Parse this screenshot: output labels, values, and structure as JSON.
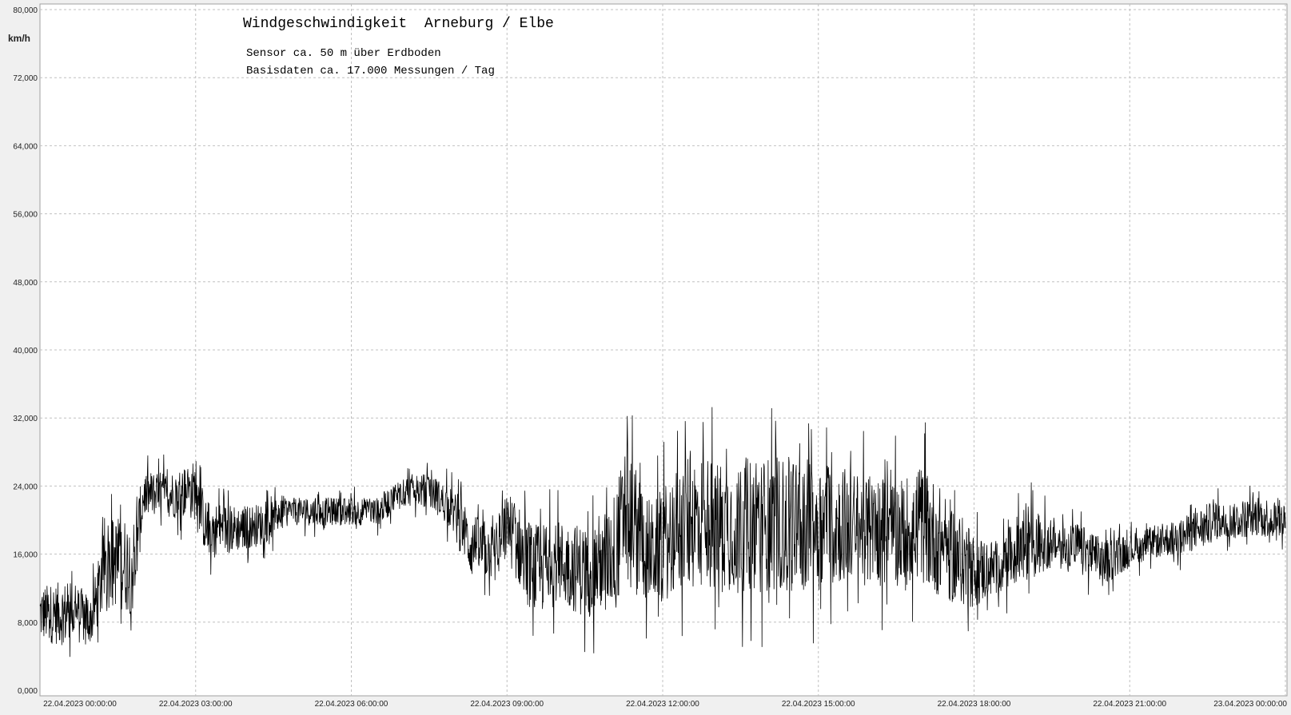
{
  "chart_data": {
    "type": "line",
    "title": "Windgeschwindigkeit  Arneburg / Elbe",
    "subtitle_lines": [
      "Sensor ca. 50 m über Erdboden",
      "Basisdaten ca. 17.000 Messungen / Tag"
    ],
    "ylabel": "km/h",
    "ylim": [
      0,
      80
    ],
    "yticks": [
      "0,000",
      "8,000",
      "16,000",
      "24,000",
      "32,000",
      "40,000",
      "48,000",
      "56,000",
      "64,000",
      "72,000",
      "80,000"
    ],
    "xlim": [
      "22.04.2023 00:00:00",
      "23.04.2023 00:00:00"
    ],
    "xticks": [
      {
        "date": "22.04.2023",
        "time": "00:00:00"
      },
      {
        "date": "22.04.2023",
        "time": "03:00:00"
      },
      {
        "date": "22.04.2023",
        "time": "06:00:00"
      },
      {
        "date": "22.04.2023",
        "time": "09:00:00"
      },
      {
        "date": "22.04.2023",
        "time": "12:00:00"
      },
      {
        "date": "22.04.2023",
        "time": "15:00:00"
      },
      {
        "date": "22.04.2023",
        "time": "18:00:00"
      },
      {
        "date": "22.04.2023",
        "time": "21:00:00"
      },
      {
        "date": "23.04.2023",
        "time": "00:00:00"
      }
    ],
    "grid": true,
    "series_color": "#000000",
    "envelope": [
      {
        "t": 0.0,
        "min": 3,
        "max": 15
      },
      {
        "t": 0.5,
        "min": 2,
        "max": 16
      },
      {
        "t": 1.0,
        "min": 3,
        "max": 14
      },
      {
        "t": 1.3,
        "min": 6,
        "max": 25
      },
      {
        "t": 1.8,
        "min": 4,
        "max": 25
      },
      {
        "t": 2.0,
        "min": 18,
        "max": 28
      },
      {
        "t": 2.5,
        "min": 18,
        "max": 28
      },
      {
        "t": 3.0,
        "min": 17,
        "max": 30
      },
      {
        "t": 3.2,
        "min": 13,
        "max": 25
      },
      {
        "t": 3.8,
        "min": 14,
        "max": 24
      },
      {
        "t": 4.3,
        "min": 15,
        "max": 24
      },
      {
        "t": 4.8,
        "min": 18,
        "max": 24
      },
      {
        "t": 5.3,
        "min": 18,
        "max": 24
      },
      {
        "t": 5.8,
        "min": 18,
        "max": 24
      },
      {
        "t": 6.5,
        "min": 18,
        "max": 24
      },
      {
        "t": 7.0,
        "min": 20,
        "max": 27
      },
      {
        "t": 7.5,
        "min": 20,
        "max": 27
      },
      {
        "t": 7.9,
        "min": 17,
        "max": 26
      },
      {
        "t": 8.3,
        "min": 10,
        "max": 24
      },
      {
        "t": 8.8,
        "min": 10,
        "max": 22
      },
      {
        "t": 9.0,
        "min": 12,
        "max": 27
      },
      {
        "t": 9.5,
        "min": 4,
        "max": 24
      },
      {
        "t": 10.0,
        "min": 6,
        "max": 24
      },
      {
        "t": 10.5,
        "min": 4,
        "max": 24
      },
      {
        "t": 11.0,
        "min": 4,
        "max": 27
      },
      {
        "t": 11.3,
        "min": 5,
        "max": 36
      },
      {
        "t": 11.8,
        "min": 5,
        "max": 27
      },
      {
        "t": 12.5,
        "min": 5,
        "max": 35
      },
      {
        "t": 13.0,
        "min": 5,
        "max": 34
      },
      {
        "t": 13.5,
        "min": 5,
        "max": 34
      },
      {
        "t": 14.0,
        "min": 5,
        "max": 34
      },
      {
        "t": 14.5,
        "min": 5,
        "max": 34
      },
      {
        "t": 15.0,
        "min": 5,
        "max": 34
      },
      {
        "t": 15.5,
        "min": 7,
        "max": 32
      },
      {
        "t": 16.0,
        "min": 7,
        "max": 30
      },
      {
        "t": 16.5,
        "min": 7,
        "max": 30
      },
      {
        "t": 17.0,
        "min": 7,
        "max": 32
      },
      {
        "t": 17.5,
        "min": 5,
        "max": 28
      },
      {
        "t": 18.0,
        "min": 6,
        "max": 22
      },
      {
        "t": 18.5,
        "min": 9,
        "max": 20
      },
      {
        "t": 19.0,
        "min": 9,
        "max": 26
      },
      {
        "t": 19.5,
        "min": 12,
        "max": 22
      },
      {
        "t": 20.0,
        "min": 12,
        "max": 22
      },
      {
        "t": 20.5,
        "min": 10,
        "max": 20
      },
      {
        "t": 21.0,
        "min": 13,
        "max": 20
      },
      {
        "t": 21.5,
        "min": 14,
        "max": 21
      },
      {
        "t": 22.0,
        "min": 14,
        "max": 22
      },
      {
        "t": 22.5,
        "min": 15,
        "max": 24
      },
      {
        "t": 23.0,
        "min": 16,
        "max": 24
      },
      {
        "t": 23.5,
        "min": 16,
        "max": 25
      },
      {
        "t": 24.0,
        "min": 16,
        "max": 24
      }
    ]
  }
}
